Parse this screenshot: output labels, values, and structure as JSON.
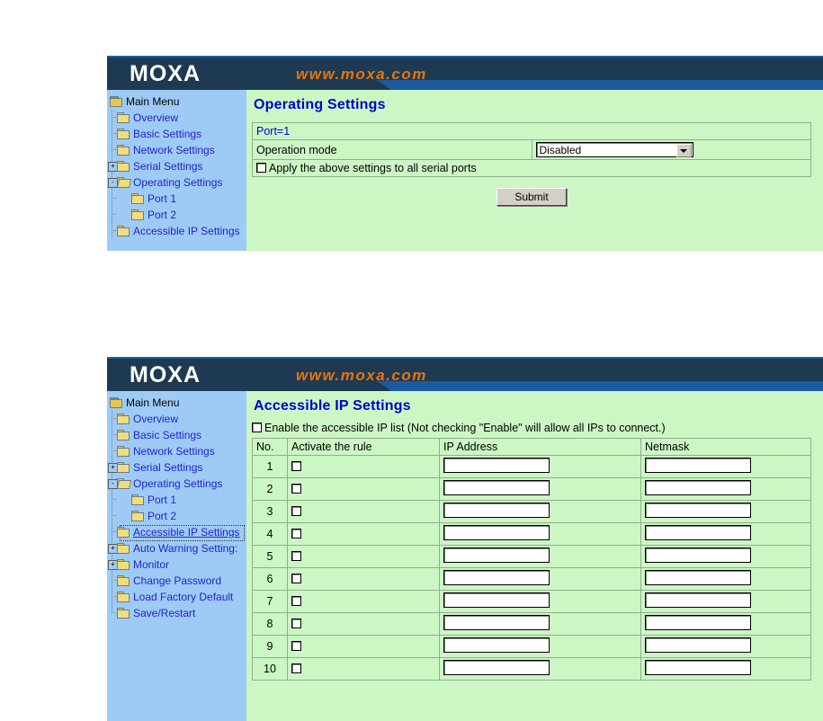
{
  "colors": {
    "banner_dark": "#1d3a52",
    "banner_blue": "#1c5a9e",
    "sidebar_blue": "#9ecbf5",
    "content_green": "#ccf7c5",
    "link_blue": "#2222cc",
    "title_blue": "#0000cc",
    "brand_orange": "#e8740c"
  },
  "brand": {
    "logo_text": "MOXA",
    "url_text": "www.moxa.com"
  },
  "tree": {
    "root_label": "Main Menu",
    "items": [
      {
        "label": "Overview",
        "level": 1,
        "expander": "",
        "icon": "folder-icon"
      },
      {
        "label": "Basic Settings",
        "level": 1,
        "expander": "",
        "icon": "folder-icon"
      },
      {
        "label": "Network Settings",
        "level": 1,
        "expander": "",
        "icon": "folder-icon"
      },
      {
        "label": "Serial Settings",
        "level": 1,
        "expander": "+",
        "icon": "folder-icon"
      },
      {
        "label": "Operating Settings",
        "level": 1,
        "expander": "-",
        "icon": "folder-open-icon"
      },
      {
        "label": "Port 1",
        "level": 2,
        "expander": "",
        "icon": "folder-icon"
      },
      {
        "label": "Port 2",
        "level": 2,
        "expander": "",
        "icon": "folder-icon"
      },
      {
        "label": "Accessible IP Settings",
        "level": 1,
        "expander": "",
        "icon": "folder-icon"
      },
      {
        "label": "Auto Warning Setting:",
        "level": 1,
        "expander": "+",
        "icon": "folder-icon"
      },
      {
        "label": "Monitor",
        "level": 1,
        "expander": "+",
        "icon": "folder-icon"
      },
      {
        "label": "Change Password",
        "level": 1,
        "expander": "",
        "icon": "folder-icon"
      },
      {
        "label": "Load Factory Default",
        "level": 1,
        "expander": "",
        "icon": "folder-icon"
      },
      {
        "label": "Save/Restart",
        "level": 1,
        "expander": "",
        "icon": "folder-icon"
      }
    ]
  },
  "panel_operating": {
    "page_title": "Operating Settings",
    "port_header": "Port=1",
    "operation_mode_label": "Operation mode",
    "operation_mode_value": "Disabled",
    "apply_all_label": "Apply the above settings to all serial ports",
    "submit_label": "Submit",
    "visible_tree_count": 8
  },
  "panel_accessible_ip": {
    "page_title": "Accessible IP Settings",
    "enable_label": "Enable the accessible IP list (Not checking \"Enable\" will allow all IPs to connect.)",
    "selected_tree_item": "Accessible IP Settings",
    "columns": [
      "No.",
      "Activate the rule",
      "IP Address",
      "Netmask"
    ],
    "rows": [
      {
        "no": "1",
        "activated": false,
        "ip": "",
        "netmask": ""
      },
      {
        "no": "2",
        "activated": false,
        "ip": "",
        "netmask": ""
      },
      {
        "no": "3",
        "activated": false,
        "ip": "",
        "netmask": ""
      },
      {
        "no": "4",
        "activated": false,
        "ip": "",
        "netmask": ""
      },
      {
        "no": "5",
        "activated": false,
        "ip": "",
        "netmask": ""
      },
      {
        "no": "6",
        "activated": false,
        "ip": "",
        "netmask": ""
      },
      {
        "no": "7",
        "activated": false,
        "ip": "",
        "netmask": ""
      },
      {
        "no": "8",
        "activated": false,
        "ip": "",
        "netmask": ""
      },
      {
        "no": "9",
        "activated": false,
        "ip": "",
        "netmask": ""
      },
      {
        "no": "10",
        "activated": false,
        "ip": "",
        "netmask": ""
      }
    ]
  }
}
